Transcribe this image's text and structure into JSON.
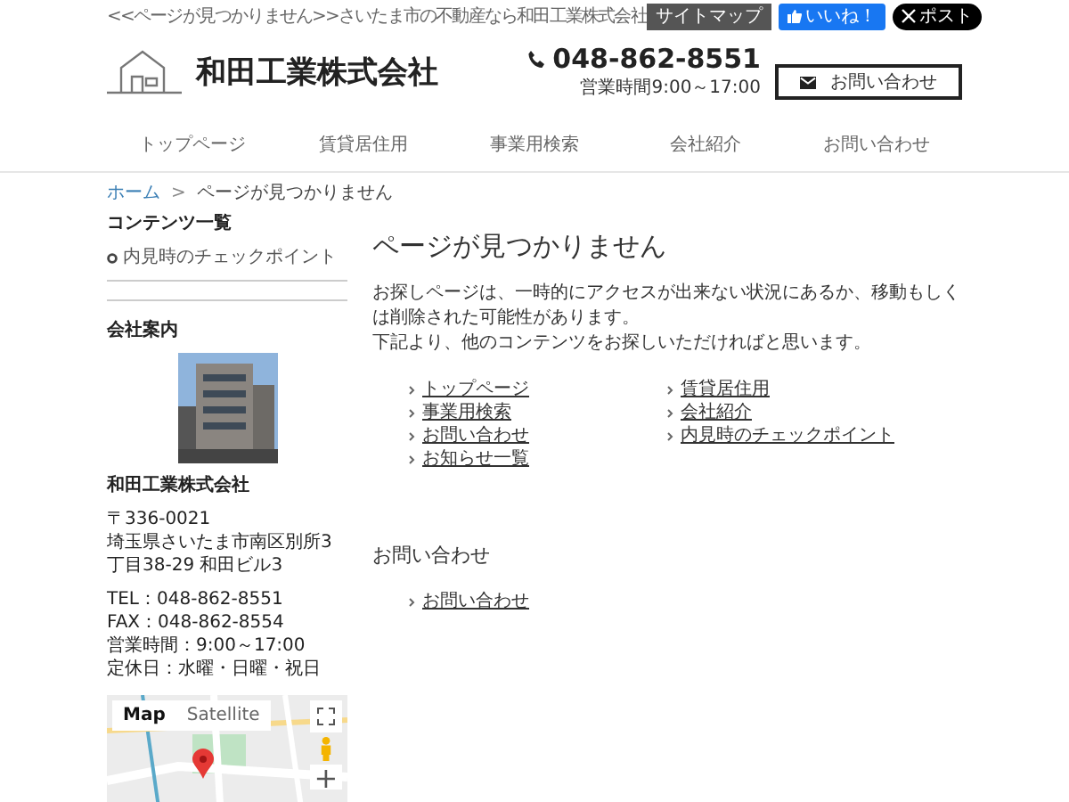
{
  "top_bar": {
    "tagline": "<<ページが見つかりません>>さいたま市の不動産なら和田工業株式会社",
    "sitemap_button": "サイトマップ",
    "like_button": "いいね！",
    "post_button": "ポスト"
  },
  "header": {
    "company": "和田工業株式会社",
    "phone": "048-862-8551",
    "hours": "営業時間9:00～17:00",
    "contact_button": "お問い合わせ"
  },
  "nav": [
    "トップページ",
    "賃貸居住用",
    "事業用検索",
    "会社紹介",
    "お問い合わせ"
  ],
  "breadcrumb": [
    {
      "label": "ホーム",
      "link": true
    },
    {
      "label": "ページが見つかりません",
      "link": false
    }
  ],
  "breadcrumb_separator": ">",
  "sidebar": {
    "contents_title": "コンテンツ一覧",
    "contents": [
      "内見時のチェックポイント"
    ],
    "company_title": "会社案内",
    "company_name": "和田工業株式会社",
    "address_lines": [
      "〒336-0021",
      "埼玉県さいたま市南区別所3丁目38-29 和田ビル3"
    ],
    "contact_lines": [
      "TEL：048-862-8551",
      "FAX：048-862-8554",
      "営業時間：9:00～17:00",
      "定休日：水曜・日曜・祝日"
    ],
    "map": {
      "map_types": [
        {
          "label": "Map",
          "selected": true
        },
        {
          "label": "Satellite",
          "selected": false
        }
      ],
      "zoom_in": "+"
    }
  },
  "main": {
    "title": "ページが見つかりません",
    "paragraphs": [
      "お探しページは、一時的にアクセスが出来ない状況にあるか、移動もしくは削除された可能性があります。",
      "下記より、他のコンテンツをお探しいただければと思います。"
    ],
    "links_left": [
      "トップページ",
      "事業用検索",
      "お問い合わせ",
      "お知らせ一覧"
    ],
    "links_right": [
      "賃貸居住用",
      "会社紹介",
      "内見時のチェックポイント"
    ],
    "contact_title": "お問い合わせ",
    "contact_links": [
      "お問い合わせ"
    ]
  }
}
